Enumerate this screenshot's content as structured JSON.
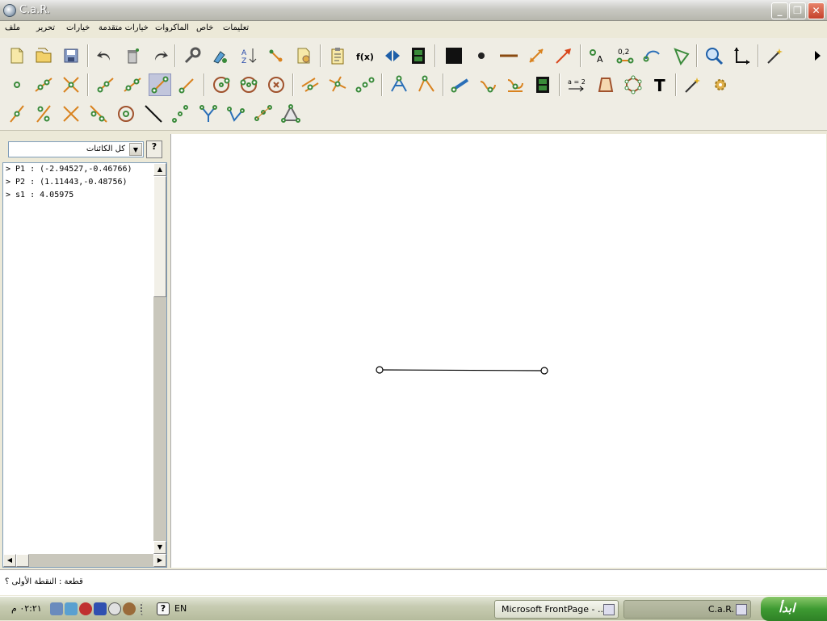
{
  "window": {
    "title": "C.a.R."
  },
  "menu": [
    "ملف",
    "تحرير",
    "خيارات",
    "خيارات متقدمة",
    "الماكروات",
    "خاص",
    "تعليمات"
  ],
  "panel": {
    "filter_value": "كل الكائنات",
    "help_label": "?",
    "objects": [
      "> P1 : (-2.94527,-0.46766)",
      "> P2 : (1.11443,-0.48756)",
      "> s1 : 4.05975"
    ]
  },
  "toolbar": {
    "fx_label": "f(x)",
    "zero_two_label": "0,2",
    "a_label": "A",
    "a_eq_2_label": "a = 2",
    "text_tool_label": "T"
  },
  "status": {
    "text": "قطعة : النقطة الأولى ؟"
  },
  "taskbar": {
    "clock": "٠٢:٢١ م",
    "lang": "EN",
    "tasks": [
      "Microsoft FrontPage - ...",
      "C.a.R."
    ],
    "start_label": "ابدأ"
  },
  "colors": {
    "accent_green": "#3a8a3a",
    "point_green": "#4aa04a",
    "line_orange": "#d9821e"
  }
}
